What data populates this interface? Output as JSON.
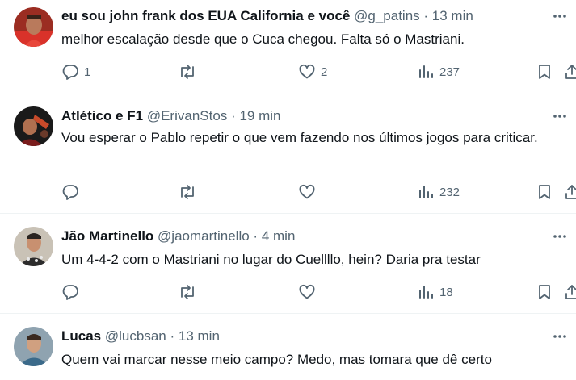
{
  "tweets": [
    {
      "name": "eu sou john frank dos EUA California e você",
      "handle": "@g_patins",
      "dot": "·",
      "time": "13 min",
      "text": "melhor escalação desde que o Cuca chegou. Falta só o Mastriani.",
      "reply_count": "1",
      "retweet_count": "",
      "like_count": "2",
      "view_count": "237"
    },
    {
      "name": "Atlético e F1",
      "handle": "@ErivanStos",
      "dot": "·",
      "time": "19 min",
      "text": "Vou esperar o Pablo repetir o que vem fazendo nos últimos jogos para criticar.",
      "reply_count": "",
      "retweet_count": "",
      "like_count": "",
      "view_count": "232"
    },
    {
      "name": "Jão Martinello",
      "handle": "@jaomartinello",
      "dot": "·",
      "time": "4 min",
      "text": "Um 4-4-2 com o Mastriani no lugar do Cuellllo, hein? Daria pra testar",
      "reply_count": "",
      "retweet_count": "",
      "like_count": "",
      "view_count": "18"
    },
    {
      "name": "Lucas",
      "handle": "@lucbsan",
      "dot": "·",
      "time": "13 min",
      "text": "Quem vai marcar nesse meio campo? Medo, mas tomara que dê certo"
    }
  ],
  "colors": {
    "text_primary": "#0f1419",
    "text_secondary": "#536471",
    "divider": "#eff3f4"
  },
  "icons": [
    "more-icon",
    "reply-icon",
    "retweet-icon",
    "like-icon",
    "views-icon",
    "bookmark-icon",
    "share-icon"
  ]
}
